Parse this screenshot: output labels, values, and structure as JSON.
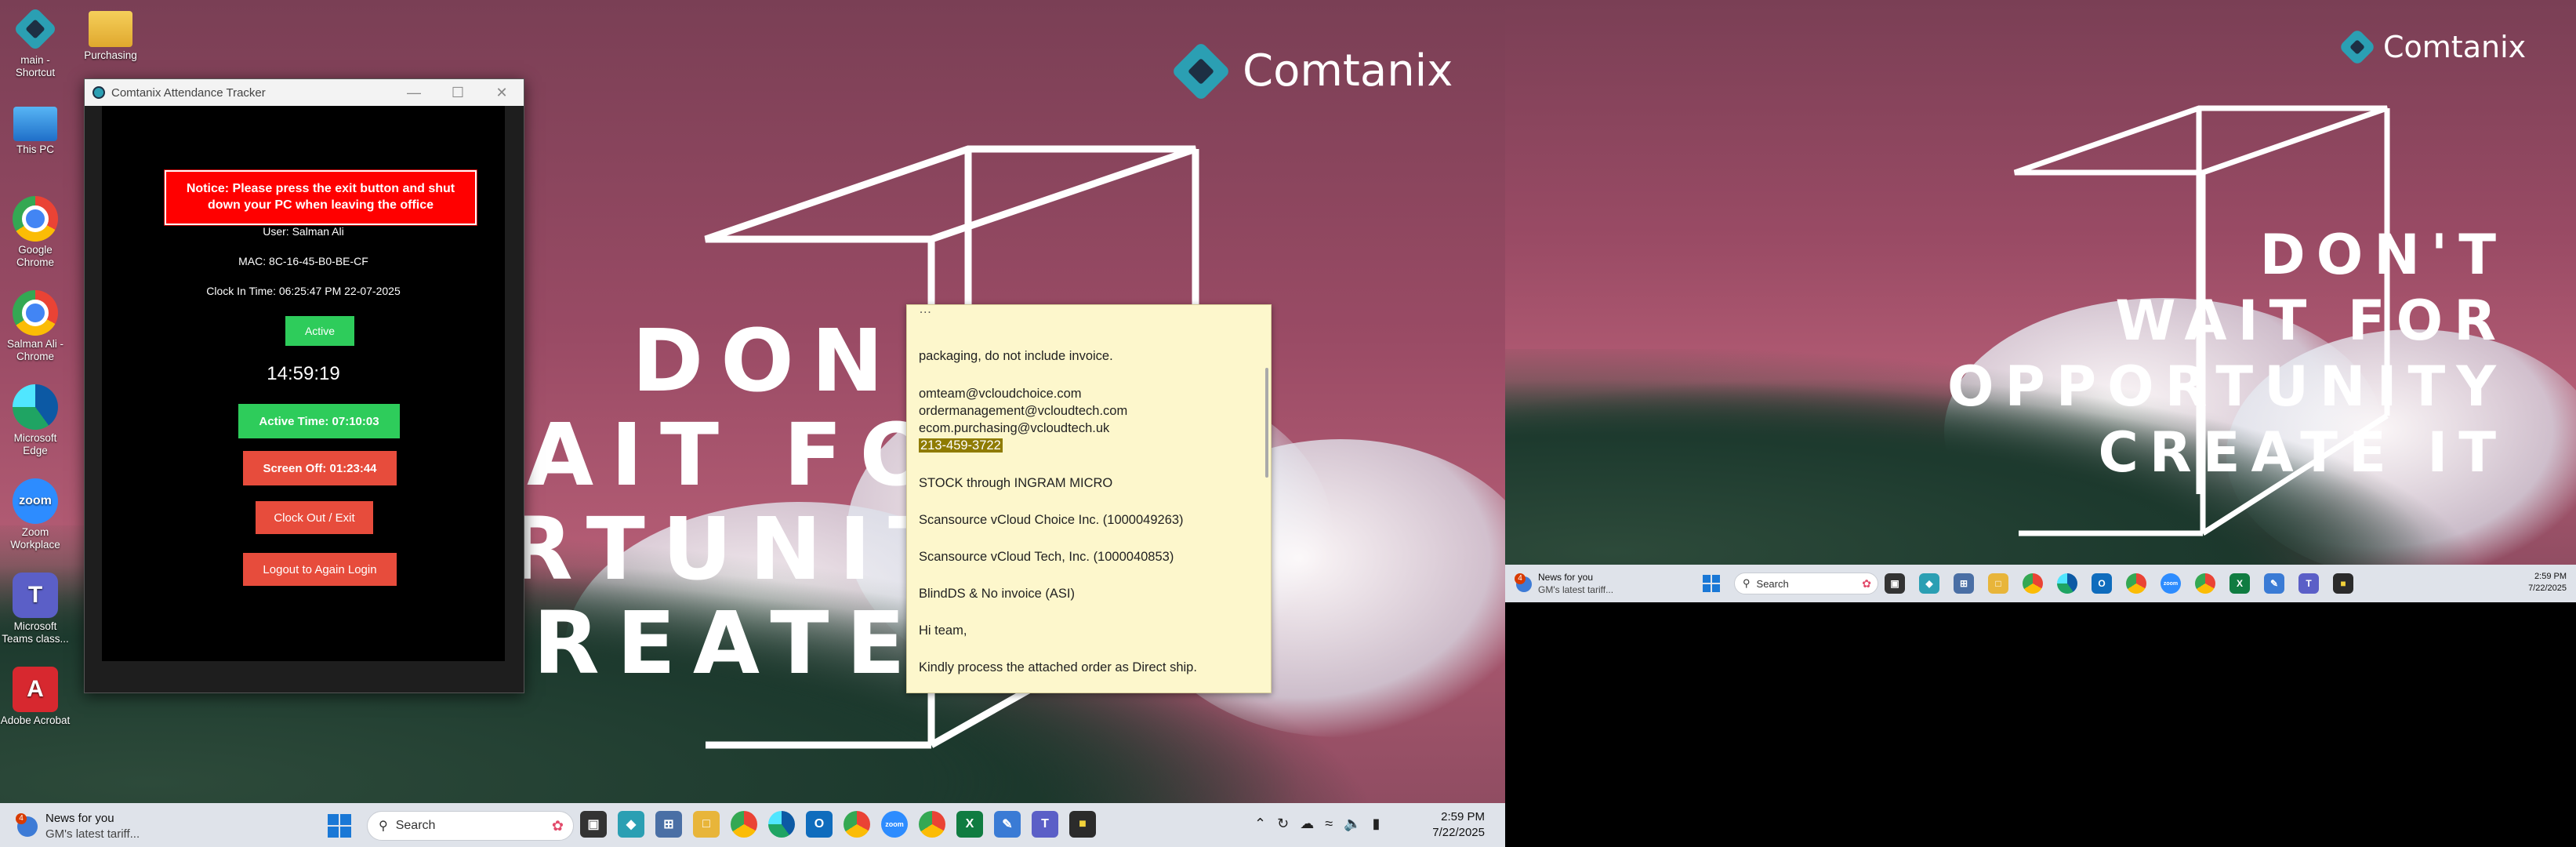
{
  "wallpaper": {
    "brand": "Comtanix",
    "lines": [
      "DON'T",
      "WAIT FOR",
      "OPPORTUNITY",
      "CREATE IT"
    ],
    "lines_clipped": [
      "DON'T",
      "AIT FOR",
      "RTUNITY",
      "REATE IT"
    ]
  },
  "desktop_icons": [
    {
      "label": "main - Shortcut",
      "icon": "app-logo-icon",
      "color": "#2b9fb3"
    },
    {
      "label": "Purchasing",
      "icon": "folder-icon",
      "color": "#e8b53a"
    },
    {
      "label": "This PC",
      "icon": "monitor-icon",
      "color": "#3a8ee6"
    },
    {
      "label": "Google Chrome",
      "icon": "chrome-icon",
      "color": "#34a853"
    },
    {
      "label": "Salman Ali - Chrome",
      "icon": "chrome-icon",
      "color": "#ea4335"
    },
    {
      "label": "Microsoft Edge",
      "icon": "edge-icon",
      "color": "#1fa463"
    },
    {
      "label": "Zoom Workplace",
      "icon": "zoom-icon",
      "color": "#2d8cff"
    },
    {
      "label": "Microsoft Teams class...",
      "icon": "teams-icon",
      "color": "#5b5fc7"
    },
    {
      "label": "Adobe Acrobat",
      "icon": "acrobat-icon",
      "color": "#d7282f"
    }
  ],
  "tracker": {
    "title": "Comtanix Attendance Tracker",
    "notice": "Notice: Please press the exit button and shut down your PC when leaving the office",
    "user": "User: Salman Ali",
    "mac": "MAC: 8C-16-45-B0-BE-CF",
    "clock_in": "Clock In Time: 06:25:47 PM 22-07-2025",
    "status": "Active",
    "clock": "14:59:19",
    "active_time": "Active Time: 07:10:03",
    "screen_off": "Screen Off: 01:23:44",
    "clock_out": "Clock Out / Exit",
    "logout": "Logout to Again Login"
  },
  "sticky": {
    "lines": [
      "packaging, do not include invoice.",
      "omteam@vcloudchoice.com",
      "ordermanagement@vcloudtech.com",
      "ecom.purchasing@vcloudtech.uk",
      "213-459-3722",
      "STOCK through INGRAM MICRO",
      "Scansource vCloud Choice Inc. (1000049263)",
      "Scansource vCloud Tech, Inc. (1000040853)",
      "BlindDS & No invoice (ASI)",
      "Hi team,",
      "Kindly process the attached order as Direct ship."
    ]
  },
  "taskbar": {
    "news_title": "News for you",
    "news_sub": "GM's latest tariff...",
    "news_badge": "4",
    "search_placeholder": "Search",
    "time": "2:59 PM",
    "date": "7/22/2025"
  }
}
